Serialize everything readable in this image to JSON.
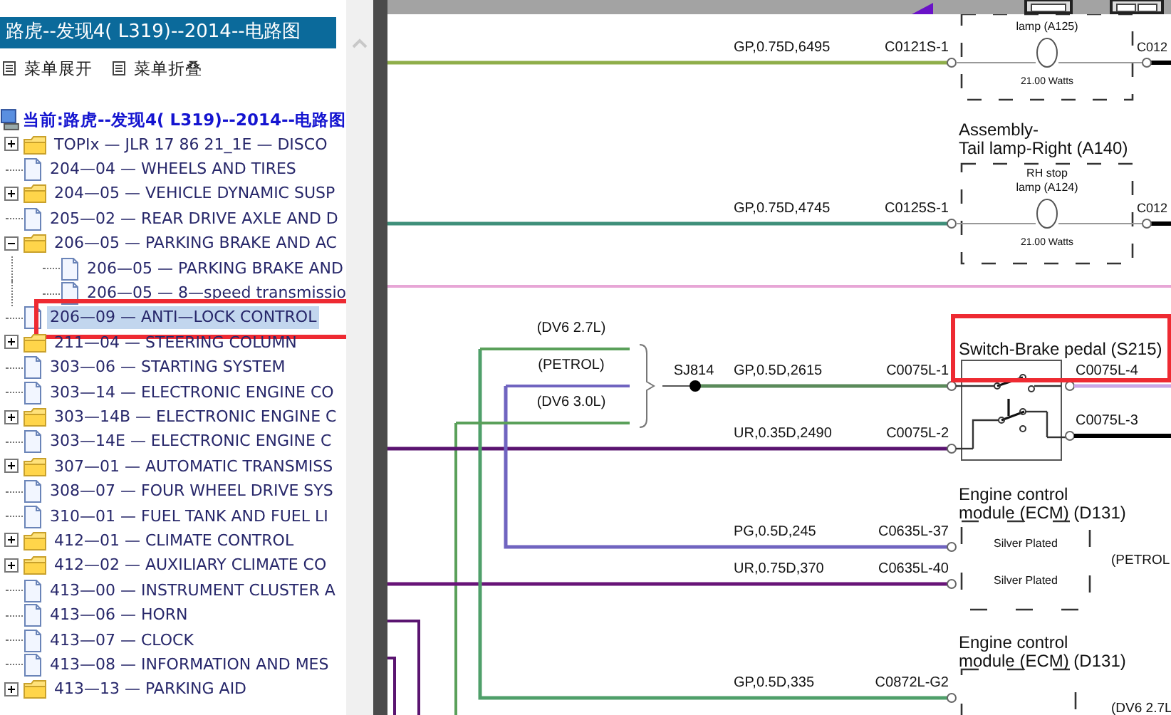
{
  "panel": {
    "title": "路虎--发现4( L319)--2014--电路图",
    "actions": [
      {
        "label": "菜单展开"
      },
      {
        "label": "菜单折叠"
      }
    ],
    "current": "当前:路虎--发现4( L319)--2014--电路图",
    "tree": [
      {
        "kind": "folder",
        "label": "TOPIx — JLR 17 86 21_1E — DISCO",
        "expanded": false,
        "selected": false,
        "highlighted": false
      },
      {
        "kind": "doc",
        "label": "204—04 — WHEELS AND TIRES",
        "selected": false,
        "highlighted": false
      },
      {
        "kind": "folder",
        "label": "204—05 — VEHICLE DYNAMIC SUSP",
        "expanded": false,
        "selected": false,
        "highlighted": false
      },
      {
        "kind": "doc",
        "label": "205—02 — REAR DRIVE AXLE AND D",
        "selected": false,
        "highlighted": false
      },
      {
        "kind": "folder",
        "label": "206—05 — PARKING BRAKE AND AC",
        "expanded": true,
        "selected": false,
        "highlighted": false,
        "children": [
          {
            "kind": "doc",
            "label": "206—05 — PARKING BRAKE AND",
            "selected": false,
            "highlighted": false
          },
          {
            "kind": "doc",
            "label": "206—05 — 8—speed transmissio",
            "selected": false,
            "highlighted": false
          }
        ]
      },
      {
        "kind": "doc",
        "label": "206—09 — ANTI—LOCK CONTROL",
        "selected": true,
        "highlighted": true
      },
      {
        "kind": "folder",
        "label": "211—04 — STEERING COLUMN",
        "expanded": false,
        "selected": false,
        "highlighted": false
      },
      {
        "kind": "doc",
        "label": "303—06 — STARTING SYSTEM",
        "selected": false,
        "highlighted": false
      },
      {
        "kind": "doc",
        "label": "303—14 — ELECTRONIC ENGINE CO",
        "selected": false,
        "highlighted": false
      },
      {
        "kind": "folder",
        "label": "303—14B — ELECTRONIC ENGINE C",
        "expanded": false,
        "selected": false,
        "highlighted": false
      },
      {
        "kind": "doc",
        "label": "303—14E — ELECTRONIC ENGINE C",
        "selected": false,
        "highlighted": false
      },
      {
        "kind": "folder",
        "label": "307—01 — AUTOMATIC TRANSMISS",
        "expanded": false,
        "selected": false,
        "highlighted": false
      },
      {
        "kind": "doc",
        "label": "308—07 — FOUR WHEEL DRIVE SYS",
        "selected": false,
        "highlighted": false
      },
      {
        "kind": "doc",
        "label": "310—01 — FUEL TANK AND FUEL LI",
        "selected": false,
        "highlighted": false
      },
      {
        "kind": "folder",
        "label": "412—01 — CLIMATE CONTROL",
        "expanded": false,
        "selected": false,
        "highlighted": false
      },
      {
        "kind": "folder",
        "label": "412—02 — AUXILIARY CLIMATE CO",
        "expanded": false,
        "selected": false,
        "highlighted": false
      },
      {
        "kind": "doc",
        "label": "413—00 — INSTRUMENT CLUSTER A",
        "selected": false,
        "highlighted": false
      },
      {
        "kind": "doc",
        "label": "413—06 — HORN",
        "selected": false,
        "highlighted": false
      },
      {
        "kind": "doc",
        "label": "413—07 — CLOCK",
        "selected": false,
        "highlighted": false
      },
      {
        "kind": "doc",
        "label": "413—08 — INFORMATION AND MES",
        "selected": false,
        "highlighted": false
      },
      {
        "kind": "folder",
        "label": "413—13 — PARKING AID",
        "expanded": false,
        "selected": false,
        "highlighted": false
      }
    ]
  },
  "diagram": {
    "wires": [
      {
        "spec": "GP,0.75D,6495",
        "connector": "C0121S-1",
        "color": "#8fae4a"
      },
      {
        "spec": "GP,0.75D,4745",
        "connector": "C0125S-1",
        "color": "#3f8f7a"
      },
      {
        "spec": "GP,0.5D,2615",
        "connector": "C0075L-1",
        "color": "#5a8a5a"
      },
      {
        "spec": "UR,0.35D,2490",
        "connector": "C0075L-2",
        "color": "#5a1470"
      },
      {
        "spec": "PG,0.5D,245",
        "connector": "C0635L-37",
        "color": "#7064c0"
      },
      {
        "spec": "UR,0.75D,370",
        "connector": "C0635L-40",
        "color": "#681478"
      },
      {
        "spec": "GP,0.5D,335",
        "connector": "C0872L-G2",
        "color": "#4f9f6a"
      }
    ],
    "variants": [
      "(DV6 2.7L)",
      "(PETROL)",
      "(DV6 3.0L)"
    ],
    "splice": "SJ814",
    "components": [
      {
        "kind": "lamp",
        "inner": [
          "lamp (A125)"
        ],
        "rating": "21.00 Watts",
        "pins": [
          "C012"
        ],
        "highlighted": false
      },
      {
        "kind": "lamp",
        "title": [
          "Assembly-",
          "Tail lamp-Right (A140)"
        ],
        "inner": [
          "RH stop",
          "lamp (A124)"
        ],
        "rating": "21.00 Watts",
        "pins": [
          "C012"
        ],
        "highlighted": false
      },
      {
        "kind": "switch",
        "title": [
          "Switch-Brake pedal (S215)"
        ],
        "pins": [
          "C0075L-4",
          "C0075L-3"
        ],
        "highlighted": true
      },
      {
        "kind": "module",
        "title": [
          "Engine control",
          "module (ECM) (D131)"
        ],
        "inner": [
          "Silver Plated",
          "Silver Plated"
        ],
        "side": "(PETROL",
        "highlighted": false
      },
      {
        "kind": "module",
        "title": [
          "Engine control",
          "module (ECM) (D131)"
        ],
        "side": "(DV6 2.7L",
        "highlighted": false
      }
    ]
  }
}
